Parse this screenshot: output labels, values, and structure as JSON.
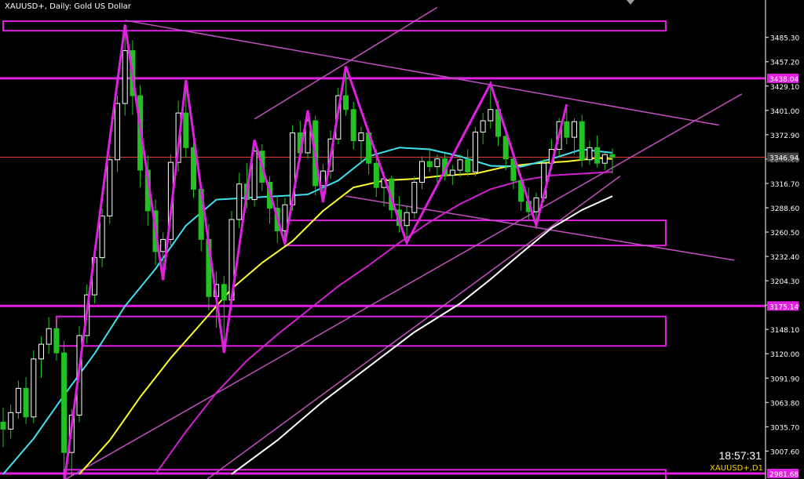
{
  "header": {
    "title": "XAUUSD+, Daily:  Gold US Dollar"
  },
  "footer": {
    "clock": "18:57:31",
    "symbol_tf": "XAUUSD+,D1"
  },
  "colors": {
    "background": "#000000",
    "bull_candle": "#ffffff",
    "bear_candle": "#22c222",
    "zigzag": "#e020e0",
    "levels": "#e020e0",
    "channel": "#c050c0",
    "ma_fast": "#40e0f0",
    "ma_mid": "#ffff30",
    "ma_slow": "#d020d0",
    "ma_long": "#ffffff",
    "price_line": "#e04030",
    "axis": "#ffffff"
  },
  "chart_data": {
    "type": "candlestick",
    "symbol": "XAUUSD+",
    "timeframe": "Daily",
    "ylim": [
      2981.68,
      3514.0
    ],
    "y_ticks": [
      "3485.30",
      "3457.20",
      "3429.10",
      "3401.00",
      "3372.90",
      "3344.80",
      "3316.70",
      "3288.60",
      "3260.50",
      "3232.40",
      "3204.30",
      "3176.20",
      "3148.10",
      "3120.00",
      "3091.90",
      "3063.80",
      "3035.70",
      "3007.60"
    ],
    "level_labels": [
      {
        "value": 3438.04,
        "label": "3438.04"
      },
      {
        "value": 3346.94,
        "label": "3346.94"
      },
      {
        "value": 3175.14,
        "label": "3175.14"
      },
      {
        "value": 2981.68,
        "label": "2981.68"
      }
    ],
    "horizontal_lines": [
      3438.04,
      3175.14,
      2981.68
    ],
    "last_price": 3346.94,
    "zones": [
      {
        "from_bar": 0,
        "to_bar": 87,
        "high": 3504.0,
        "low": 3493.0
      },
      {
        "from_bar": 37,
        "to_bar": 87,
        "high": 3274.0,
        "low": 3245.0
      },
      {
        "from_bar": 7,
        "to_bar": 87,
        "high": 3163.0,
        "low": 3129.0
      },
      {
        "from_bar": 8,
        "to_bar": 87,
        "high": 2986.0,
        "low": 2970.0
      }
    ],
    "zigzag": [
      {
        "bar": 8,
        "price": 2970.0
      },
      {
        "bar": 16,
        "price": 3500.0
      },
      {
        "bar": 21,
        "price": 3205.0
      },
      {
        "bar": 24,
        "price": 3436.0
      },
      {
        "bar": 29,
        "price": 3121.0
      },
      {
        "bar": 33,
        "price": 3367.0
      },
      {
        "bar": 37,
        "price": 3247.0
      },
      {
        "bar": 40,
        "price": 3401.0
      },
      {
        "bar": 42,
        "price": 3295.0
      },
      {
        "bar": 45,
        "price": 3452.0
      },
      {
        "bar": 53,
        "price": 3248.0
      },
      {
        "bar": 64,
        "price": 3432.0
      },
      {
        "bar": 70,
        "price": 3268.0
      },
      {
        "bar": 74,
        "price": 3408.0
      }
    ],
    "trendlines": [
      {
        "b1": 16,
        "p1": 3505.0,
        "b2": 94,
        "p2": 3384.0
      },
      {
        "b1": 45,
        "p1": 3302.0,
        "b2": 96,
        "p2": 3228.0
      },
      {
        "b1": 33,
        "p1": 3391.0,
        "b2": 57,
        "p2": 3520.0
      },
      {
        "b1": 8,
        "p1": 2974.0,
        "b2": 97,
        "p2": 3420.0
      },
      {
        "b1": 26,
        "p1": 2970.0,
        "b2": 81,
        "p2": 3325.0
      }
    ],
    "ma_fast": [
      [
        0,
        2981
      ],
      [
        4,
        3022
      ],
      [
        8,
        3072
      ],
      [
        12,
        3120
      ],
      [
        16,
        3175
      ],
      [
        20,
        3218
      ],
      [
        24,
        3268
      ],
      [
        28,
        3298
      ],
      [
        32,
        3300
      ],
      [
        36,
        3302
      ],
      [
        40,
        3304
      ],
      [
        44,
        3320
      ],
      [
        48,
        3348
      ],
      [
        52,
        3358
      ],
      [
        56,
        3356
      ],
      [
        60,
        3348
      ],
      [
        64,
        3337
      ],
      [
        68,
        3336
      ],
      [
        72,
        3345
      ],
      [
        76,
        3356
      ],
      [
        80,
        3352
      ]
    ],
    "ma_mid": [
      [
        10,
        2981
      ],
      [
        14,
        3020
      ],
      [
        18,
        3070
      ],
      [
        22,
        3115
      ],
      [
        26,
        3155
      ],
      [
        30,
        3195
      ],
      [
        34,
        3225
      ],
      [
        38,
        3250
      ],
      [
        42,
        3285
      ],
      [
        46,
        3312
      ],
      [
        50,
        3320
      ],
      [
        54,
        3322
      ],
      [
        58,
        3326
      ],
      [
        62,
        3328
      ],
      [
        66,
        3336
      ],
      [
        70,
        3340
      ],
      [
        74,
        3342
      ],
      [
        78,
        3346
      ],
      [
        80,
        3345
      ]
    ],
    "ma_slow": [
      [
        20,
        2981
      ],
      [
        24,
        3030
      ],
      [
        28,
        3075
      ],
      [
        32,
        3112
      ],
      [
        36,
        3142
      ],
      [
        40,
        3170
      ],
      [
        44,
        3198
      ],
      [
        48,
        3222
      ],
      [
        52,
        3248
      ],
      [
        56,
        3272
      ],
      [
        60,
        3293
      ],
      [
        64,
        3310
      ],
      [
        68,
        3320
      ],
      [
        72,
        3326
      ],
      [
        76,
        3328
      ],
      [
        80,
        3330
      ]
    ],
    "ma_long": [
      [
        30,
        2981
      ],
      [
        36,
        3020
      ],
      [
        42,
        3065
      ],
      [
        48,
        3105
      ],
      [
        54,
        3145
      ],
      [
        60,
        3178
      ],
      [
        64,
        3206
      ],
      [
        68,
        3236
      ],
      [
        72,
        3265
      ],
      [
        76,
        3286
      ],
      [
        80,
        3302
      ]
    ],
    "candles": [
      [
        3041,
        3058,
        3012,
        3033
      ],
      [
        3033,
        3061,
        3022,
        3052
      ],
      [
        3052,
        3089,
        3045,
        3080
      ],
      [
        3080,
        3093,
        3039,
        3047
      ],
      [
        3047,
        3124,
        3040,
        3114
      ],
      [
        3114,
        3140,
        3092,
        3131
      ],
      [
        3131,
        3162,
        3120,
        3149
      ],
      [
        3149,
        3158,
        3112,
        3121
      ],
      [
        3121,
        3135,
        2970,
        3006
      ],
      [
        3006,
        3056,
        2978,
        3049
      ],
      [
        3049,
        3152,
        3041,
        3141
      ],
      [
        3141,
        3200,
        3132,
        3188
      ],
      [
        3188,
        3240,
        3178,
        3231
      ],
      [
        3231,
        3288,
        3220,
        3279
      ],
      [
        3279,
        3350,
        3270,
        3344
      ],
      [
        3344,
        3418,
        3330,
        3409
      ],
      [
        3409,
        3500,
        3395,
        3470
      ],
      [
        3470,
        3482,
        3396,
        3418
      ],
      [
        3418,
        3430,
        3312,
        3332
      ],
      [
        3332,
        3349,
        3268,
        3285
      ],
      [
        3285,
        3298,
        3222,
        3238
      ],
      [
        3238,
        3260,
        3205,
        3252
      ],
      [
        3252,
        3350,
        3245,
        3341
      ],
      [
        3341,
        3412,
        3330,
        3398
      ],
      [
        3398,
        3436,
        3346,
        3358
      ],
      [
        3358,
        3368,
        3300,
        3310
      ],
      [
        3310,
        3318,
        3238,
        3252
      ],
      [
        3252,
        3270,
        3170,
        3186
      ],
      [
        3186,
        3215,
        3150,
        3200
      ],
      [
        3200,
        3210,
        3121,
        3182
      ],
      [
        3182,
        3285,
        3170,
        3275
      ],
      [
        3275,
        3329,
        3265,
        3316
      ],
      [
        3316,
        3340,
        3288,
        3298
      ],
      [
        3298,
        3367,
        3290,
        3354
      ],
      [
        3354,
        3362,
        3308,
        3318
      ],
      [
        3318,
        3325,
        3270,
        3288
      ],
      [
        3288,
        3302,
        3248,
        3262
      ],
      [
        3262,
        3300,
        3247,
        3292
      ],
      [
        3292,
        3384,
        3285,
        3375
      ],
      [
        3375,
        3389,
        3342,
        3352
      ],
      [
        3352,
        3401,
        3345,
        3389
      ],
      [
        3389,
        3395,
        3303,
        3314
      ],
      [
        3314,
        3339,
        3295,
        3331
      ],
      [
        3331,
        3378,
        3322,
        3368
      ],
      [
        3368,
        3427,
        3362,
        3418
      ],
      [
        3418,
        3452,
        3395,
        3402
      ],
      [
        3402,
        3411,
        3356,
        3366
      ],
      [
        3366,
        3382,
        3340,
        3375
      ],
      [
        3375,
        3379,
        3327,
        3340
      ],
      [
        3340,
        3356,
        3301,
        3312
      ],
      [
        3312,
        3330,
        3290,
        3322
      ],
      [
        3322,
        3326,
        3276,
        3286
      ],
      [
        3286,
        3302,
        3260,
        3268
      ],
      [
        3268,
        3291,
        3248,
        3283
      ],
      [
        3283,
        3325,
        3276,
        3318
      ],
      [
        3318,
        3348,
        3310,
        3342
      ],
      [
        3342,
        3358,
        3330,
        3336
      ],
      [
        3336,
        3350,
        3318,
        3345
      ],
      [
        3345,
        3351,
        3320,
        3326
      ],
      [
        3326,
        3338,
        3315,
        3332
      ],
      [
        3332,
        3350,
        3324,
        3344
      ],
      [
        3344,
        3356,
        3325,
        3330
      ],
      [
        3330,
        3382,
        3325,
        3376
      ],
      [
        3376,
        3398,
        3362,
        3389
      ],
      [
        3389,
        3432,
        3380,
        3402
      ],
      [
        3402,
        3412,
        3360,
        3371
      ],
      [
        3371,
        3382,
        3332,
        3345
      ],
      [
        3345,
        3352,
        3310,
        3320
      ],
      [
        3320,
        3328,
        3285,
        3296
      ],
      [
        3296,
        3312,
        3275,
        3284
      ],
      [
        3284,
        3306,
        3268,
        3300
      ],
      [
        3300,
        3345,
        3295,
        3340
      ],
      [
        3340,
        3368,
        3332,
        3356
      ],
      [
        3356,
        3392,
        3348,
        3388
      ],
      [
        3388,
        3408,
        3362,
        3370
      ],
      [
        3370,
        3392,
        3350,
        3388
      ],
      [
        3388,
        3396,
        3336,
        3344
      ],
      [
        3344,
        3366,
        3338,
        3358
      ],
      [
        3358,
        3372,
        3335,
        3340
      ],
      [
        3340,
        3352,
        3332,
        3350
      ],
      [
        3350,
        3357,
        3328,
        3346.94
      ]
    ]
  }
}
